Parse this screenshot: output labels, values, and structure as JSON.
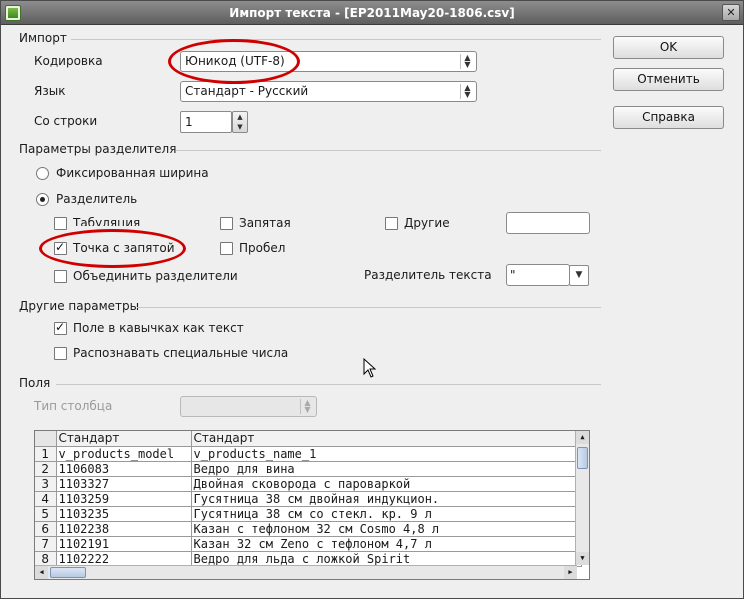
{
  "window": {
    "title": "Импорт текста - [EP2011May20-1806.csv]",
    "close_glyph": "✕"
  },
  "import": {
    "section": "Импорт",
    "encoding_label": "Кодировка",
    "encoding_value": "Юникод (UTF-8)",
    "language_label": "Язык",
    "language_value": "Стандарт - Русский",
    "from_row_label": "Со строки",
    "from_row_value": "1"
  },
  "separator": {
    "section": "Параметры разделителя",
    "fixed_width": "Фиксированная ширина",
    "separated_by": "Разделитель",
    "tab": "Табуляция",
    "comma": "Запятая",
    "other": "Другие",
    "semicolon": "Точка с запятой",
    "space": "Пробел",
    "merge": "Объединить разделители",
    "text_delimiter_label": "Разделитель текста",
    "text_delimiter_value": "\"",
    "tab_checked": false,
    "comma_checked": false,
    "other_checked": false,
    "semicolon_checked": true,
    "space_checked": false,
    "merge_checked": false,
    "mode": "separated"
  },
  "other_options": {
    "section": "Другие параметры",
    "quoted_as_text": "Поле в кавычках как текст",
    "quoted_as_text_checked": true,
    "detect_special": "Распознавать специальные числа",
    "detect_special_checked": false
  },
  "fields": {
    "section": "Поля",
    "column_type_label": "Тип столбца",
    "column_type_value": "",
    "headers": [
      "Стандарт",
      "Стандарт"
    ],
    "rows": [
      {
        "n": "1",
        "c1": "v_products_model",
        "c2": "v_products_name_1"
      },
      {
        "n": "2",
        "c1": "1106083",
        "c2": "Ведро для вина"
      },
      {
        "n": "3",
        "c1": "1103327",
        "c2": "Двойная сковорода с пароваркой"
      },
      {
        "n": "4",
        "c1": "1103259",
        "c2": "Гусятница 38  см двойная индукцион."
      },
      {
        "n": "5",
        "c1": "1103235",
        "c2": "Гусятница 38 см со стекл. кр. 9 л"
      },
      {
        "n": "6",
        "c1": "1102238",
        "c2": "Казан  с тефлоном 32 см Cosmo 4,8 л"
      },
      {
        "n": "7",
        "c1": "1102191",
        "c2": "Казан  32 см Zeno с тефлоном 4,7 л"
      },
      {
        "n": "8",
        "c1": "1102222",
        "c2": "Ведро для льда с ложкой Spirit"
      }
    ]
  },
  "buttons": {
    "ok": "OK",
    "cancel": "Отменить",
    "help": "Справка"
  },
  "colors": {
    "annotation": "#d00000",
    "titlebar": "#6f6f6f"
  }
}
